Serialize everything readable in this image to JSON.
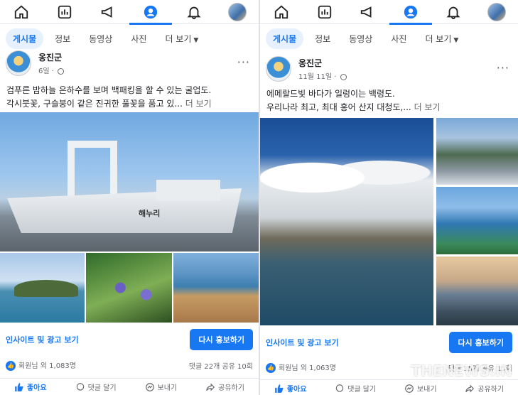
{
  "left": {
    "subtabs": [
      "게시물",
      "정보",
      "동영상",
      "사진",
      "더 보기"
    ],
    "post": {
      "author": "옹진군",
      "time": "6일 ·",
      "caption_line1": "검푸른 밤하늘 은하수를 보며 백패킹을 할 수 있는 굴업도.",
      "caption_line2": "각시붓꽃, 구슬붕이 같은 진귀한 풀꽃을 품고 있...",
      "more_link": "더 보기",
      "ship_name": "해누리",
      "insight": "인사이트 및 광고 보기",
      "promote": "다시 홍보하기",
      "likes": "회원님 외 1,083명",
      "comments_shares": "댓글 22개  공유 10회",
      "like_btn": "좋아요",
      "comment_btn": "댓글 달기",
      "send_btn": "보내기",
      "share_btn": "공유하기"
    }
  },
  "right": {
    "subtabs": [
      "게시물",
      "정보",
      "동영상",
      "사진",
      "더 보기"
    ],
    "post": {
      "author": "옹진군",
      "time": "11월 11일 ·",
      "caption_line1": "에메랄드빛 바다가 일렁이는 백령도.",
      "caption_line2": "우리나라 최고, 최대 홍어 산지 대청도,...",
      "more_link": "더 보기",
      "insight": "인사이트 및 광고 보기",
      "promote": "다시 홍보하기",
      "likes": "회원님 외 1,063명",
      "comments_shares": "댓글 15개  공유 15회",
      "like_btn": "좋아요",
      "comment_btn": "댓글 달기",
      "send_btn": "보내기",
      "share_btn": "공유하기"
    }
  },
  "watermark": "THENEWS.IN",
  "colors": {
    "accent": "#1877f2",
    "muted": "#65676b"
  }
}
